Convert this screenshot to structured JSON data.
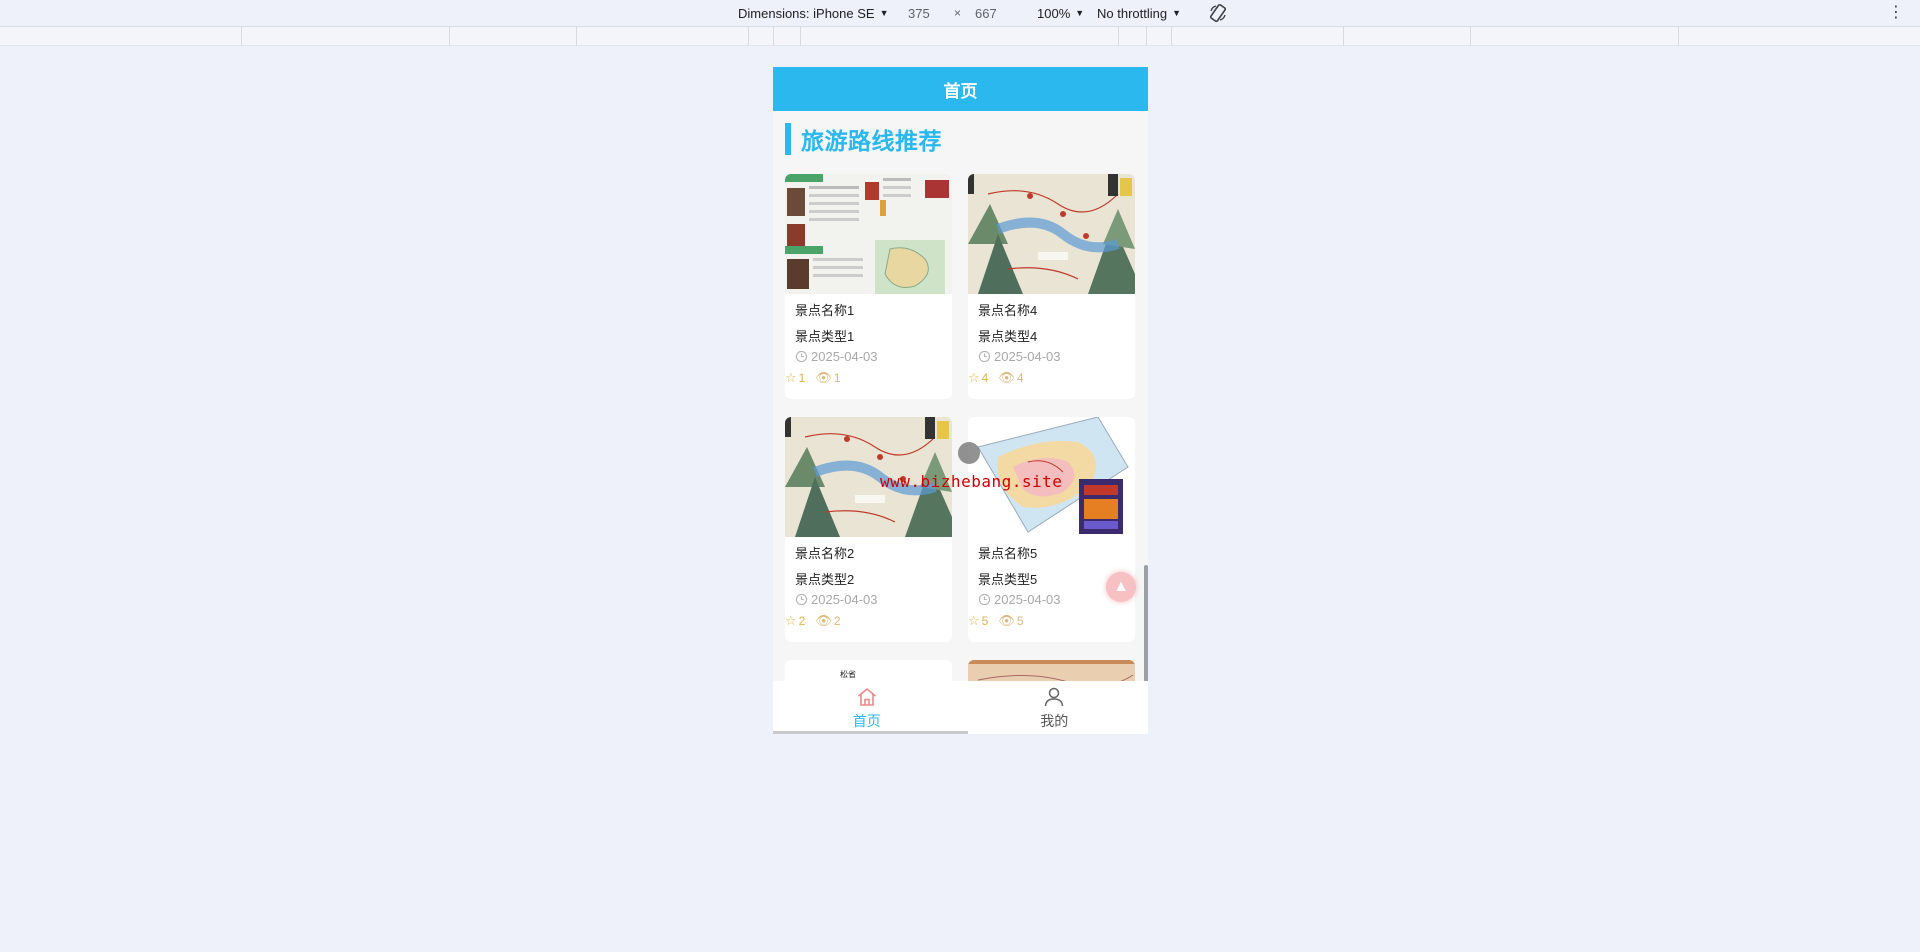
{
  "devtools": {
    "dimensions_label": "Dimensions: iPhone SE",
    "width_value": "375",
    "times": "×",
    "height_value": "667",
    "zoom_label": "100%",
    "throttle_label": "No throttling",
    "more_icon": "⋮"
  },
  "app": {
    "header_title": "首页",
    "section_title": "旅游路线推荐",
    "watermark": "www.bizhebang.site",
    "back_top_icon": "▲",
    "accent_color": "#2ab8ef"
  },
  "cards": [
    {
      "name": "景点名称1",
      "type": "景点类型1",
      "date": "2025-04-03",
      "favorites": "1",
      "views": "1"
    },
    {
      "name": "景点名称4",
      "type": "景点类型4",
      "date": "2025-04-03",
      "favorites": "4",
      "views": "4"
    },
    {
      "name": "景点名称2",
      "type": "景点类型2",
      "date": "2025-04-03",
      "favorites": "2",
      "views": "2"
    },
    {
      "name": "景点名称5",
      "type": "景点类型5",
      "date": "2025-04-03",
      "favorites": "5",
      "views": "5"
    }
  ],
  "partial_card_text": "松省",
  "tabbar": {
    "home_label": "首页",
    "mine_label": "我的"
  }
}
